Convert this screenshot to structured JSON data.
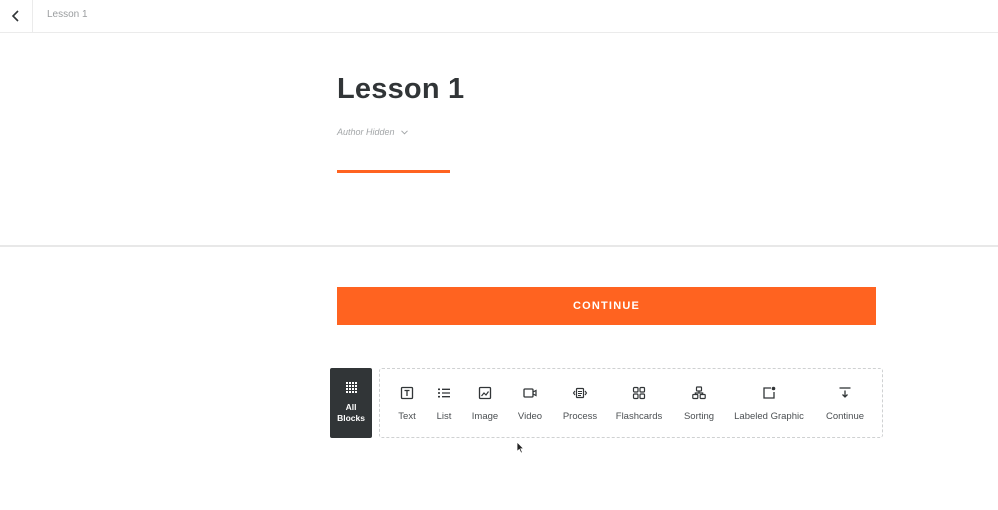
{
  "topbar": {
    "breadcrumb": "Lesson 1",
    "back_icon": "chevron-left-icon"
  },
  "lesson": {
    "title": "Lesson 1",
    "author": "Author Hidden",
    "accent_color": "#ff6320"
  },
  "continue_button": {
    "label": "CONTINUE"
  },
  "block_tray": {
    "all_blocks_label_line1": "All",
    "all_blocks_label_line2": "Blocks",
    "tools": [
      {
        "label": "Text",
        "icon": "text-icon"
      },
      {
        "label": "List",
        "icon": "list-icon"
      },
      {
        "label": "Image",
        "icon": "image-icon"
      },
      {
        "label": "Video",
        "icon": "video-icon"
      },
      {
        "label": "Process",
        "icon": "process-icon"
      },
      {
        "label": "Flashcards",
        "icon": "flashcards-icon"
      },
      {
        "label": "Sorting",
        "icon": "sorting-icon"
      },
      {
        "label": "Labeled Graphic",
        "icon": "labeled-graphic-icon"
      },
      {
        "label": "Continue",
        "icon": "continue-icon"
      }
    ]
  }
}
